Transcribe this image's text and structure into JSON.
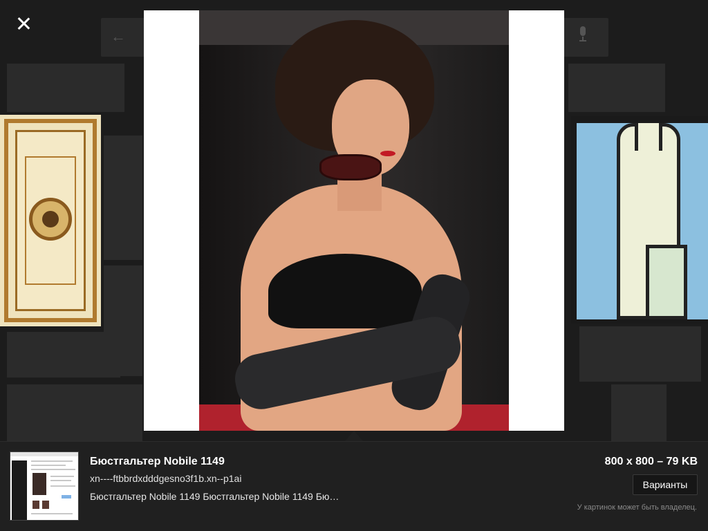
{
  "viewer": {
    "close_label": "×"
  },
  "result": {
    "title": "Бюстгальтер Nobile 1149",
    "domain": "xn----ftbbrdxdddgesno3f1b.xn--p1ai",
    "description": "Бюстгальтер Nobile 1149 Бюстгальтер Nobile 1149 Бю…",
    "size": "800 x 800 – 79 KB",
    "variants_label": "Варианты",
    "copyright_note": "У картинок может быть владелец."
  },
  "icons": {
    "close": "close-icon",
    "back": "back-arrow-icon",
    "mic": "microphone-icon"
  },
  "colors": {
    "background": "#1c1c1c",
    "panel": "#202020",
    "lingerie_accent": "#b0222d"
  }
}
